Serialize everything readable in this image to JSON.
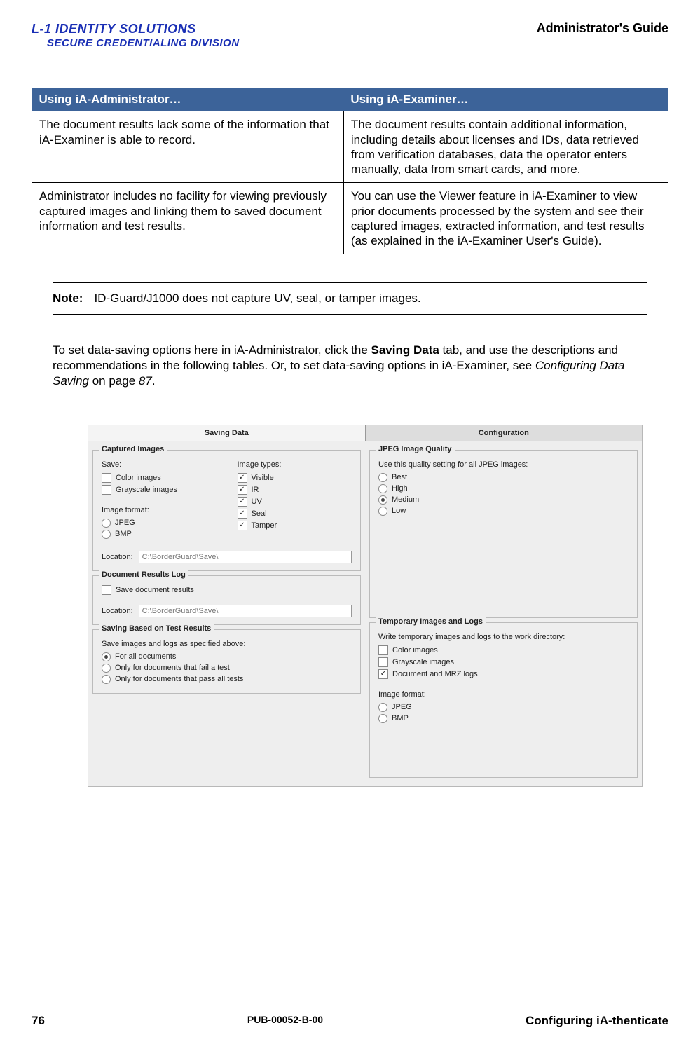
{
  "header": {
    "logo_line1": "L-1 IDENTITY SOLUTIONS",
    "logo_line2": "SECURE CREDENTIALING DIVISION",
    "guide_title": "Administrator's Guide"
  },
  "table": {
    "head_left": "Using iA-Administrator…",
    "head_right": "Using iA-Examiner…",
    "r1_left": "The document results lack some of the information that iA-Examiner is able to record.",
    "r1_right": "The document results contain additional information, including details about licenses and IDs, data retrieved from verification databases, data the operator enters manually, data from smart cards, and more.",
    "r2_left": "Administrator includes no facility for viewing previously captured images and linking them to saved document information and test results.",
    "r2_right": "You can use the Viewer feature in iA-Examiner to view prior documents processed by the system and see their captured images, extracted information, and test results (as explained in the iA-Examiner User's Guide)."
  },
  "note": {
    "label": "Note:",
    "text": "ID-Guard/J1000 does not capture UV, seal, or tamper images."
  },
  "para": {
    "p1": "To set data-saving options here in iA-Administrator, click the ",
    "p2_bold": "Saving Data",
    "p3": " tab, and use the descriptions and recommendations in the following tables. Or, to set data-saving options in iA-Examiner, see ",
    "p4_ital": "Configuring Data Saving",
    "p5": " on page ",
    "p6_ital": "87",
    "p7": "."
  },
  "ui": {
    "tab_saving": "Saving Data",
    "tab_config": "Configuration",
    "grp_captured": "Captured Images",
    "lbl_save": "Save:",
    "ck_color": "Color images",
    "ck_gray": "Grayscale images",
    "lbl_imgtypes": "Image types:",
    "ck_visible": "Visible",
    "ck_ir": "IR",
    "ck_uv": "UV",
    "ck_seal": "Seal",
    "ck_tamper": "Tamper",
    "lbl_imgfmt": "Image format:",
    "rd_jpeg": "JPEG",
    "rd_bmp": "BMP",
    "lbl_location": "Location:",
    "loc_path": "C:\\BorderGuard\\Save\\",
    "grp_doclog": "Document Results Log",
    "ck_savedoc": "Save document results",
    "grp_savetest": "Saving Based on Test Results",
    "lbl_saveimgs": "Save images and logs as specified above:",
    "rd_alldocs": "For all documents",
    "rd_faildocs": "Only for documents that fail a test",
    "rd_passdocs": "Only for documents that pass all tests",
    "grp_jpeg": "JPEG Image Quality",
    "lbl_usequal": "Use this quality setting for all JPEG images:",
    "rd_best": "Best",
    "rd_high": "High",
    "rd_medium": "Medium",
    "rd_low": "Low",
    "grp_temp": "Temporary Images and Logs",
    "lbl_writetemp": "Write temporary images and logs to the work directory:",
    "ck_tcolor": "Color images",
    "ck_tgray": "Grayscale images",
    "ck_tdocmrz": "Document and MRZ logs"
  },
  "footer": {
    "page": "76",
    "pub": "PUB-00052-B-00",
    "section": "Configuring iA-thenticate"
  }
}
